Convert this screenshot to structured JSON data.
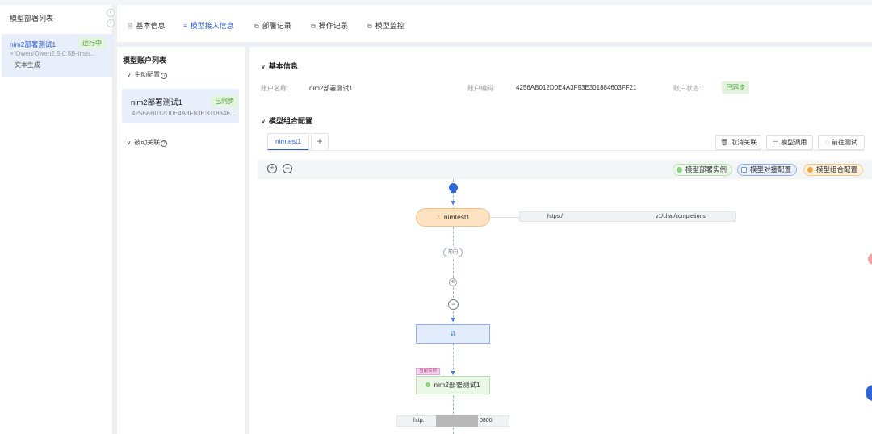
{
  "left_panel": {
    "title": "模型部署列表",
    "collapse_left": "‹",
    "collapse_right": "›",
    "item": {
      "name": "nim2部署测试1",
      "status": "运行中",
      "model": "Qwen/Qwen2.5-0.5B-Instr...",
      "type": "文本生成"
    }
  },
  "tabs": [
    {
      "label": "基本信息",
      "icon": "🗎"
    },
    {
      "label": "模型接入信息",
      "icon": "≡"
    },
    {
      "label": "部署记录",
      "icon": "⧉"
    },
    {
      "label": "操作记录",
      "icon": "⧉"
    },
    {
      "label": "模型监控",
      "icon": "⧉"
    }
  ],
  "account_list": {
    "title": "模型账户列表",
    "active_section": "主动配置",
    "passive_section": "被动关联",
    "card": {
      "name": "nim2部署测试1",
      "badge": "已同步",
      "code": "4256AB012D0E4A3F93E3018846..."
    }
  },
  "basic_info": {
    "heading": "基本信息",
    "account_name_label": "账户名称:",
    "account_name_value": "nim2部署测试1",
    "account_code_label": "账户编码:",
    "account_code_value": "4256AB012D0E4A3F93E301884603FF21",
    "account_status_label": "账户状态:",
    "account_status_value": "已同步"
  },
  "combo_config": {
    "heading": "模型组合配置",
    "subtab": "nimtest1",
    "add_label": "+",
    "buttons": {
      "unlink": "取消关联",
      "invoke": "模型调用",
      "test": "前往测试"
    },
    "zoom_in": "+",
    "zoom_out": "−",
    "legend": {
      "instance": "模型部署实例",
      "interface": "模型对接配置",
      "combo": "模型组合配置"
    },
    "flow": {
      "combo_node": "nimtest1",
      "url_top_prefix": "https:/",
      "url_top_suffix": "v1/chat/completions",
      "pill": "前向",
      "minus": "−",
      "current_tag": "当前实例",
      "instance_node": "nim2部署测试1",
      "url_bottom_prefix": "http:",
      "url_bottom_suffix": "0800"
    }
  },
  "colors": {
    "primary": "#2c5fd9",
    "synced_bg": "#e2f3de",
    "synced_text": "#4a9a3c",
    "combo_node": "#fde3c2",
    "instance_node": "#eaf7e7"
  }
}
